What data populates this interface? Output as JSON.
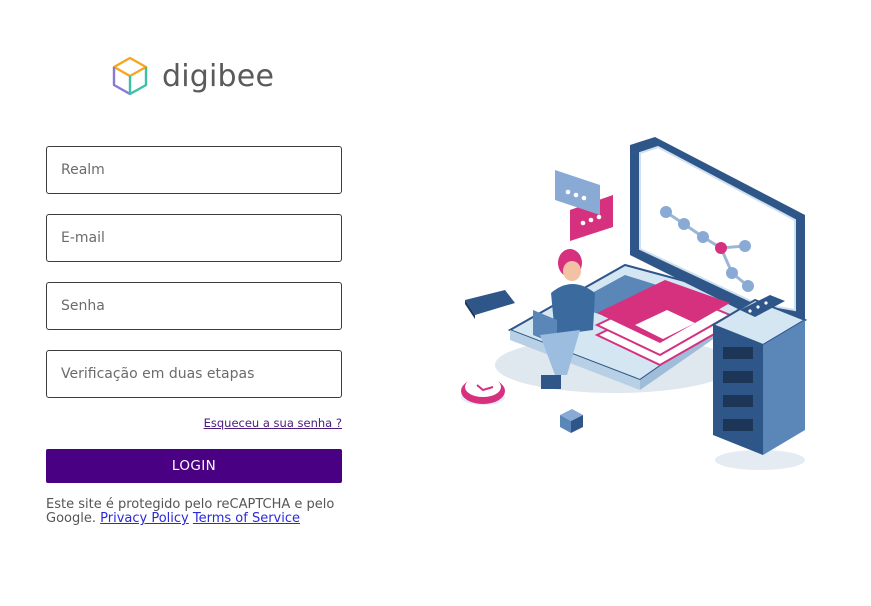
{
  "brand": {
    "name": "digibee",
    "colors": {
      "primary": "#4a0082",
      "pink": "#d6317f",
      "blue": "#3b6a9e"
    }
  },
  "form": {
    "realm_placeholder": "Realm",
    "email_placeholder": "E-mail",
    "password_placeholder": "Senha",
    "twofa_placeholder": "Verificação em duas etapas",
    "forgot_label": "Esqueceu a sua senha ?",
    "login_label": "LOGIN"
  },
  "recaptcha": {
    "text": "Este site é protegido pelo reCAPTCHA e pelo Google.",
    "privacy_label": "Privacy Policy",
    "terms_label": "Terms of Service"
  },
  "illustration": {
    "icons": [
      "cube-logo-icon",
      "laptop-icon",
      "server-rack-icon",
      "chat-bubble-icon",
      "person-icon",
      "clock-icon",
      "book-icon"
    ]
  }
}
